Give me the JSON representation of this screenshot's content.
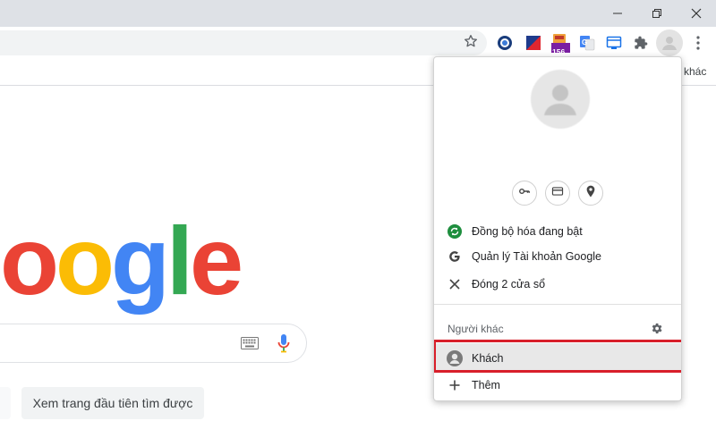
{
  "window": {
    "minimize_icon": "minimize-icon",
    "maximize_icon": "restore-icon",
    "close_icon": "close-icon"
  },
  "toolbar": {
    "star_icon": "bookmark-star-icon",
    "extensions": [
      {
        "icon": "extension-blue-circle-icon"
      },
      {
        "icon": "extension-red-flag-icon"
      },
      {
        "icon": "extension-badge-icon",
        "badge": "156"
      },
      {
        "icon": "google-translate-icon"
      },
      {
        "icon": "extension-monitor-icon"
      },
      {
        "icon": "puzzle-icon"
      }
    ],
    "menu_icon": "kebab-menu-icon"
  },
  "bookmarks_bar": {
    "other_label": "khác"
  },
  "google_page": {
    "logo_letters": [
      "o",
      "o",
      "g",
      "l",
      "e"
    ],
    "logo_colors": [
      "#ea4335",
      "#fbbc05",
      "#4285f4",
      "#34a853",
      "#ea4335"
    ],
    "lucky_button_label": "Xem trang đầu tiên tìm được"
  },
  "profile_popup": {
    "quick_actions": [
      {
        "icon": "key-icon"
      },
      {
        "icon": "credit-card-icon"
      },
      {
        "icon": "location-pin-icon"
      }
    ],
    "items": [
      {
        "icon": "sync-icon",
        "label": "Đồng bộ hóa đang bật"
      },
      {
        "icon": "google-g-icon",
        "label": "Quản lý Tài khoản Google"
      },
      {
        "icon": "close-icon",
        "label": "Đóng 2 cửa sổ"
      }
    ],
    "others_label": "Người khác",
    "guest_label": "Khách",
    "add_label": "Thêm",
    "highlight_color": "#d81f2a"
  }
}
